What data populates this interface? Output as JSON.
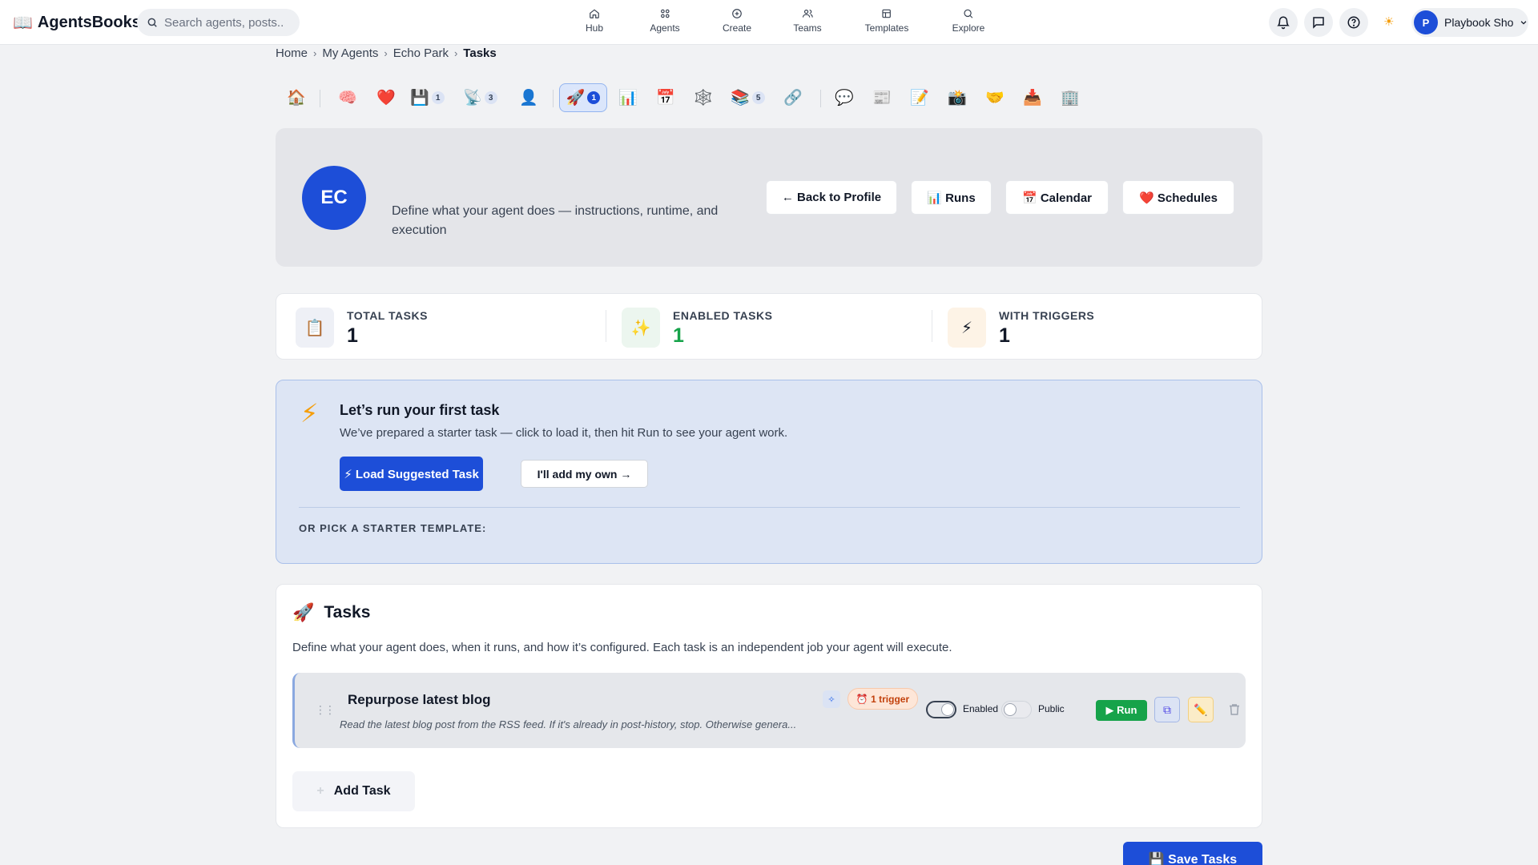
{
  "brand": {
    "icon": "📖",
    "name": "AgentsBooks"
  },
  "search": {
    "placeholder": "Search agents, posts..."
  },
  "nav": {
    "items": [
      {
        "label": "Hub",
        "icon": "home-icon"
      },
      {
        "label": "Agents",
        "icon": "grid-icon"
      },
      {
        "label": "Create",
        "icon": "plus-circle-icon"
      },
      {
        "label": "Teams",
        "icon": "users-icon"
      },
      {
        "label": "Templates",
        "icon": "template-icon"
      },
      {
        "label": "Explore",
        "icon": "search-icon"
      }
    ],
    "theme_icon": "☀",
    "profile": {
      "initial": "P",
      "name": "Playbook Sho"
    }
  },
  "breadcrumb": {
    "items": [
      "Home",
      "My Agents",
      "Echo Park"
    ],
    "current": "Tasks",
    "separator": "›"
  },
  "tabs": [
    {
      "icon": "🏠",
      "name": "home",
      "badge": ""
    },
    {
      "icon": "🧠",
      "name": "brain",
      "badge": ""
    },
    {
      "icon": "❤️",
      "name": "heart",
      "badge": ""
    },
    {
      "icon": "💾",
      "name": "save",
      "badge": "1"
    },
    {
      "icon": "📡",
      "name": "satellite",
      "badge": "3"
    },
    {
      "icon": "👤",
      "name": "person",
      "badge": ""
    },
    {
      "icon": "🚀",
      "name": "tasks",
      "badge": "1",
      "active": true
    },
    {
      "icon": "📊",
      "name": "chart",
      "badge": ""
    },
    {
      "icon": "📅",
      "name": "calendar",
      "badge": ""
    },
    {
      "icon": "🕸️",
      "name": "web",
      "badge": ""
    },
    {
      "icon": "📚",
      "name": "books",
      "badge": "5"
    },
    {
      "icon": "🔗",
      "name": "link",
      "badge": ""
    },
    {
      "icon": "💬",
      "name": "chat",
      "badge": ""
    },
    {
      "icon": "📰",
      "name": "news",
      "badge": ""
    },
    {
      "icon": "📝",
      "name": "notes",
      "badge": ""
    },
    {
      "icon": "📸",
      "name": "camera",
      "badge": ""
    },
    {
      "icon": "🤝",
      "name": "handshake",
      "badge": ""
    },
    {
      "icon": "📥",
      "name": "inbox",
      "badge": ""
    },
    {
      "icon": "🏢",
      "name": "building",
      "badge": ""
    }
  ],
  "header": {
    "avatar": "EC",
    "description": "Define what your agent does — instructions, runtime, and execution",
    "buttons": {
      "back": "← Back to Profile",
      "runs": "📊 Runs",
      "calendar": "📅 Calendar",
      "schedules": "❤️ Schedules"
    }
  },
  "stats": [
    {
      "icon": "📋",
      "label": "TOTAL TASKS",
      "value": "1",
      "color": "#111827",
      "bg": "#eef0f6"
    },
    {
      "icon": "✨",
      "label": "ENABLED TASKS",
      "value": "1",
      "color": "#16a34a",
      "bg": "#ecf6ef"
    },
    {
      "icon": "⚡",
      "label": "WITH TRIGGERS",
      "value": "1",
      "color": "#111827",
      "bg": "#fdf3e6"
    }
  ],
  "first_task": {
    "icon": "⚡",
    "title": "Let’s run your first task",
    "subtitle": "We’ve prepared a starter task — click to load it, then hit Run to see your agent work.",
    "primary": "⚡ Load Suggested Task",
    "secondary": "I'll add my own →",
    "pick_label": "OR PICK A STARTER TEMPLATE:"
  },
  "tasks": {
    "icon": "🚀",
    "title": "Tasks",
    "intro": "Define what your agent does, when it runs, and how it’s configured. Each task is an independent job your agent will execute.",
    "items": [
      {
        "name": "Repurpose latest blog",
        "preview": "Read the latest blog post from the RSS feed. If it's already in post-history, stop. Otherwise genera...",
        "trigger": "⏰ 1 trigger",
        "enabled_label": "Enabled",
        "enabled": true,
        "public_label": "Public",
        "public": false,
        "run_label": "▶ Run"
      }
    ],
    "add_label": "Add Task",
    "add_icon": "+"
  },
  "save": {
    "label": "💾 Save Tasks"
  },
  "colors": {
    "accent": "#1d4ed8",
    "run": "#16a34a",
    "trigger": "#c2410c"
  }
}
